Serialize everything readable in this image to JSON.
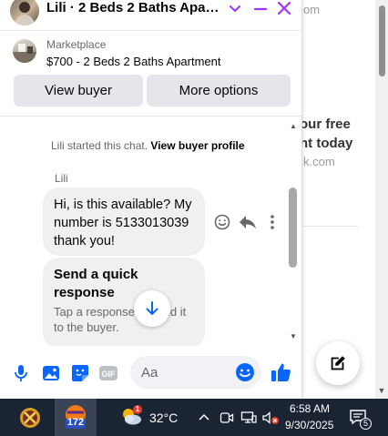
{
  "background_page": {
    "url_fragment_1": "om",
    "heading_line_1": "our free",
    "heading_line_2": "nt today",
    "url_fragment_2": "k.com"
  },
  "chat": {
    "header": {
      "title": "Lili · 2 Beds 2 Baths Apart..."
    },
    "marketplace": {
      "label": "Marketplace",
      "listing_title": "$700 - 2 Beds 2 Baths Apartment"
    },
    "actions": {
      "view_buyer": "View buyer",
      "more_options": "More options"
    },
    "system_message": {
      "text": "Lili started this chat.",
      "link": "View buyer profile"
    },
    "messages": [
      {
        "sender": "Lili",
        "text": "Hi, is this available? My number is 5133013039 thank you!"
      }
    ],
    "quick_response": {
      "title": "Send a quick response",
      "subtitle": "Tap a response to send it to the buyer."
    },
    "composer": {
      "placeholder": "Aa"
    }
  },
  "taskbar": {
    "app_badge_count": "172",
    "weather_alert_count": "1",
    "temperature": "32°C",
    "time": "6:58 AM",
    "date": "9/30/2025",
    "notification_count": "5"
  },
  "colors": {
    "accent": "#0866ff",
    "header_icon": "#a033ff",
    "bubble": "#f0f0f0",
    "button": "#e4e6eb",
    "taskbar": "#1b2433"
  }
}
